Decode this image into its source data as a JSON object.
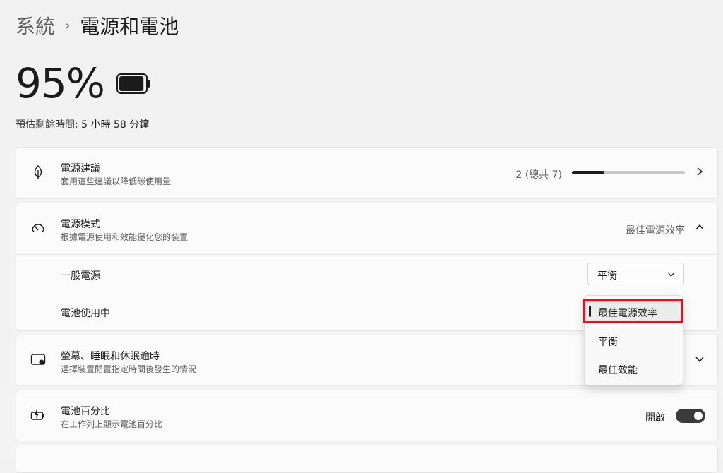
{
  "breadcrumb": {
    "parent": "系統",
    "separator": "›",
    "current": "電源和電池"
  },
  "battery": {
    "percent_text": "95%",
    "level": 0.95,
    "estimate_label": "預估剩餘時間:",
    "estimate_value": "5 小時 58 分鐘"
  },
  "power_recommendations": {
    "title": "電源建議",
    "subtitle": "套用這些建議以降低碳使用量",
    "count_text": "2 (總共 7)",
    "progress": 0.286
  },
  "power_mode": {
    "title": "電源模式",
    "subtitle": "根據電源使用和效能優化您的裝置",
    "value": "最佳電源效率",
    "plugged_in_label": "一般電源",
    "plugged_in_value": "平衡",
    "on_battery_label": "電池使用中"
  },
  "dropdown": {
    "options": [
      "最佳電源效率",
      "平衡",
      "最佳效能"
    ],
    "selected_index": 0,
    "highlight_color": "#e0141f"
  },
  "screen_sleep": {
    "title": "螢幕、睡眠和休眠逾時",
    "subtitle": "選擇裝置閒置指定時間後發生的情況"
  },
  "battery_percentage": {
    "title": "電池百分比",
    "subtitle": "在工作列上顯示電池百分比",
    "toggle_label": "開啟",
    "toggle_on": true
  },
  "icons": {
    "leaf": "leaf-icon",
    "gauge": "gauge-icon",
    "screen": "screen-sleep-icon",
    "battery": "battery-charging-icon"
  }
}
